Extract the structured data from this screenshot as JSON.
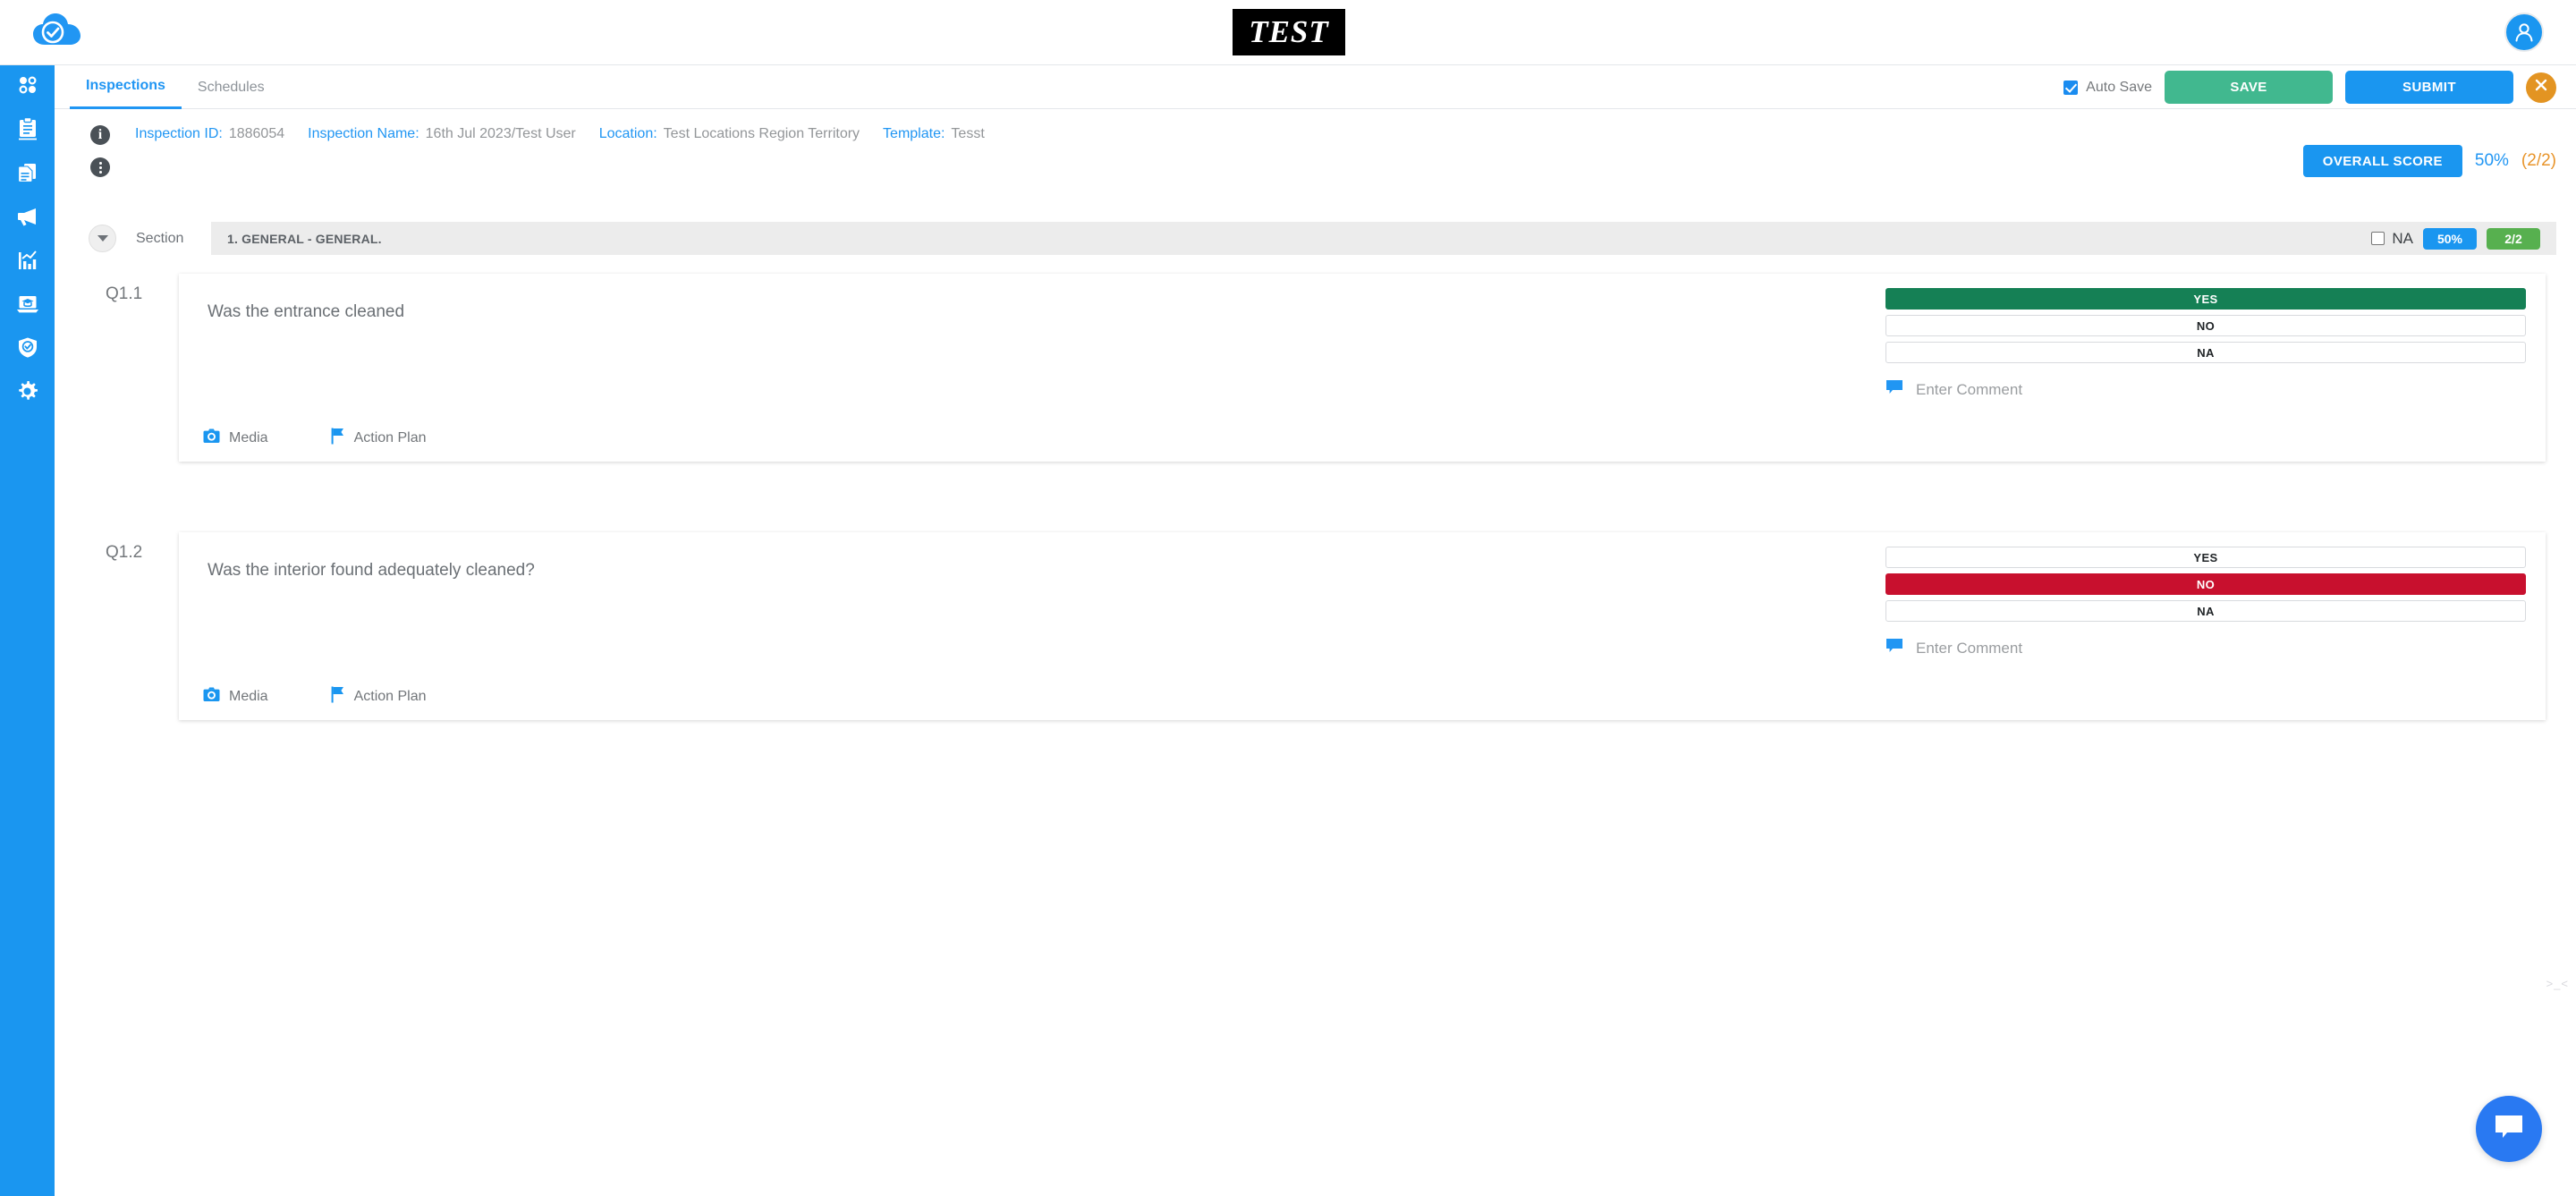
{
  "header": {
    "logo_icon": "cloud-check-icon",
    "brand_text": "TEST",
    "avatar_icon": "user-avatar-icon"
  },
  "sidebar": {
    "items": [
      {
        "name": "dashboard",
        "icon": "four-dots-grid-icon"
      },
      {
        "name": "inspections",
        "icon": "clipboard-icon"
      },
      {
        "name": "documents",
        "icon": "documents-icon"
      },
      {
        "name": "announcements",
        "icon": "megaphone-icon"
      },
      {
        "name": "analytics",
        "icon": "bar-chart-icon"
      },
      {
        "name": "training",
        "icon": "laptop-graduation-icon"
      },
      {
        "name": "compliance",
        "icon": "shield-check-icon"
      },
      {
        "name": "settings",
        "icon": "gear-icon"
      }
    ]
  },
  "tabs": [
    {
      "label": "Inspections",
      "active": true
    },
    {
      "label": "Schedules",
      "active": false
    }
  ],
  "toolbar": {
    "autosave_label": "Auto Save",
    "autosave_checked": true,
    "save_label": "SAVE",
    "submit_label": "SUBMIT",
    "close_icon": "close-x-icon",
    "save_color": "#41b88f",
    "submit_color": "#1a96f0",
    "close_color": "#e39422"
  },
  "info": {
    "fields": [
      {
        "label": "Inspection ID:",
        "value": "1886054"
      },
      {
        "label": "Inspection Name:",
        "value": "16th Jul 2023/Test User"
      },
      {
        "label": "Location:",
        "value": "Test Locations Region Territory"
      },
      {
        "label": "Template:",
        "value": "Tesst"
      }
    ],
    "overall_score_label": "OVERALL SCORE",
    "overall_score_percent": "50%",
    "overall_score_fraction": "(2/2)"
  },
  "section": {
    "label": "Section",
    "title": "1. GENERAL - GENERAL.",
    "na_label": "NA",
    "na_checked": false,
    "percent_badge": "50%",
    "count_badge": "2/2"
  },
  "questions": [
    {
      "number": "Q1.1",
      "text": "Was the entrance cleaned",
      "media_label": "Media",
      "action_plan_label": "Action Plan",
      "comment_placeholder": "Enter Comment",
      "options": [
        "YES",
        "NO",
        "NA"
      ],
      "selected": "YES",
      "selected_color": "#158055"
    },
    {
      "number": "Q1.2",
      "text": "Was the interior found adequately cleaned?",
      "media_label": "Media",
      "action_plan_label": "Action Plan",
      "comment_placeholder": "Enter Comment",
      "options": [
        "YES",
        "NO",
        "NA"
      ],
      "selected": "NO",
      "selected_color": "#c8102e"
    }
  ],
  "chat": {
    "icon": "chat-bubble-icon"
  },
  "watermark": {
    "text": ">_<"
  }
}
